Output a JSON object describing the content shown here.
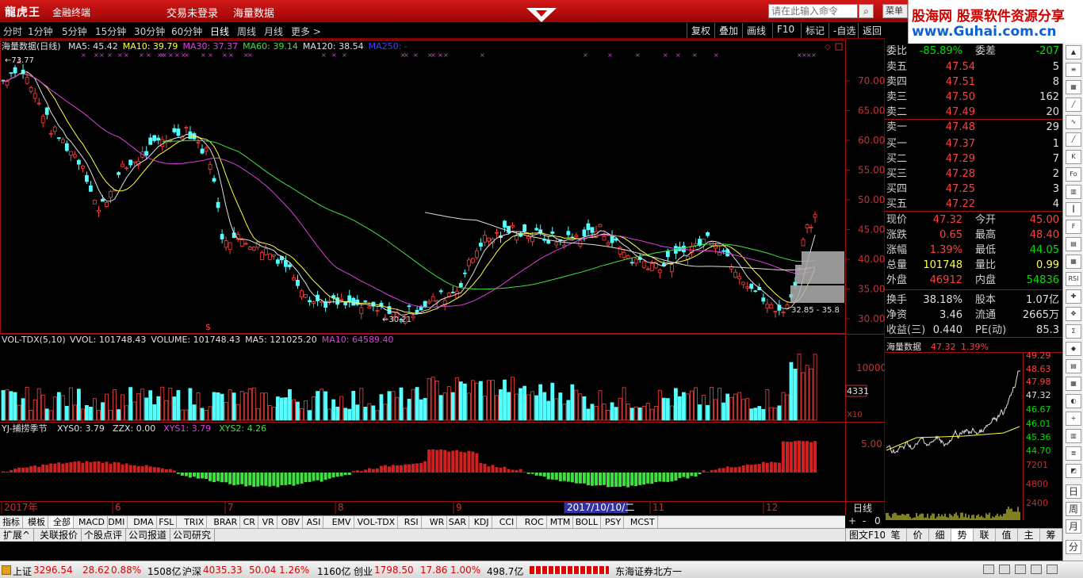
{
  "titlebar": {
    "logo": "龍虎王",
    "app_name": "金融终端",
    "menu": [
      "交易未登录",
      "海量数据"
    ],
    "command_placeholder": "请在此输入命令",
    "menu_button": "菜单"
  },
  "ad": {
    "line1_a": "股海网",
    "line1_b": "股票软件资源分享",
    "line2": "www.Guhai.com.cn"
  },
  "toolbar": {
    "periods": [
      "分时",
      "1分钟",
      "5分钟",
      "15分钟",
      "30分钟",
      "60分钟",
      "日线",
      "周线",
      "月线",
      "更多 >"
    ],
    "active_period": "日线",
    "buttons": [
      "复权",
      "叠加",
      "画线",
      "F10",
      "标记",
      "-自选",
      "返回"
    ]
  },
  "main_chart": {
    "title": "海量数据(日线)",
    "ma_labels": [
      {
        "text": "MA5: 45.42",
        "color": "#e0e0e0"
      },
      {
        "text": "MA10: 39.79",
        "color": "#ffff40"
      },
      {
        "text": "MA30: 37.37",
        "color": "#e040e0"
      },
      {
        "text": "MA60: 39.14",
        "color": "#40e040"
      },
      {
        "text": "MA120: 38.54",
        "color": "#e0e0e0"
      },
      {
        "text": "MA250: -",
        "color": "#4040ff"
      }
    ],
    "high_label": "73.77",
    "low_label": "30.21",
    "range_label": "32.85 - 35.8",
    "y_ticks": [
      "70.00",
      "65.00",
      "60.00",
      "55.00",
      "50.00",
      "45.00",
      "40.00",
      "35.00",
      "30.00"
    ],
    "y_tick_values": [
      70,
      65,
      60,
      55,
      50,
      45,
      40,
      35,
      30
    ]
  },
  "vol_chart": {
    "label_main": "VOL-TDX(5,10)",
    "labels": [
      {
        "text": "VVOL: 101748.43",
        "color": "#e0e0e0"
      },
      {
        "text": "VOLUME: 101748.43",
        "color": "#e0e0e0"
      },
      {
        "text": "MA5: 121025.20",
        "color": "#e0e0e0"
      },
      {
        "text": "MA10: 64589.40",
        "color": "#e040e0"
      }
    ],
    "y_tick": "10000",
    "box_value": "4331",
    "unit": "X10"
  },
  "ind_chart": {
    "label_main": "YJ-捕捞季节",
    "labels": [
      {
        "text": "XYS0: 3.79",
        "color": "#e0e0e0"
      },
      {
        "text": "ZZX: 0.00",
        "color": "#e0e0e0"
      },
      {
        "text": "XYS1: 3.79",
        "color": "#e040e0"
      },
      {
        "text": "XYS2: 4.26",
        "color": "#40e040"
      }
    ],
    "y_tick": "5.00"
  },
  "x_axis": {
    "labels": [
      "2017年",
      "6",
      "7",
      "8",
      "9",
      "2017/10/10/二",
      "11",
      "12"
    ],
    "right_label": "日线"
  },
  "order_book": {
    "weibi_label": "委比",
    "weibi": "-85.89%",
    "weicha_label": "委差",
    "weicha": "-207",
    "asks": [
      {
        "label": "卖五",
        "price": "47.54",
        "vol": "5"
      },
      {
        "label": "卖四",
        "price": "47.51",
        "vol": "8"
      },
      {
        "label": "卖三",
        "price": "47.50",
        "vol": "162"
      },
      {
        "label": "卖二",
        "price": "47.49",
        "vol": "20"
      },
      {
        "label": "卖一",
        "price": "47.48",
        "vol": "29"
      }
    ],
    "bids": [
      {
        "label": "买一",
        "price": "47.37",
        "vol": "1"
      },
      {
        "label": "买二",
        "price": "47.29",
        "vol": "7"
      },
      {
        "label": "买三",
        "price": "47.28",
        "vol": "2"
      },
      {
        "label": "买四",
        "price": "47.25",
        "vol": "3"
      },
      {
        "label": "买五",
        "price": "47.22",
        "vol": "4"
      }
    ],
    "stats": [
      {
        "l1": "现价",
        "v1": "47.32",
        "c1": "red",
        "l2": "今开",
        "v2": "45.00",
        "c2": "red"
      },
      {
        "l1": "涨跌",
        "v1": "0.65",
        "c1": "red",
        "l2": "最高",
        "v2": "48.40",
        "c2": "red"
      },
      {
        "l1": "涨幅",
        "v1": "1.39%",
        "c1": "red",
        "l2": "最低",
        "v2": "44.05",
        "c2": "grn"
      },
      {
        "l1": "总量",
        "v1": "101748",
        "c1": "yel",
        "l2": "量比",
        "v2": "0.99",
        "c2": "yel"
      },
      {
        "l1": "外盘",
        "v1": "46912",
        "c1": "red",
        "l2": "内盘",
        "v2": "54836",
        "c2": "grn"
      },
      {
        "l1": "换手",
        "v1": "38.18%",
        "c1": "wht",
        "l2": "股本",
        "v2": "1.07亿",
        "c2": "wht"
      },
      {
        "l1": "净资",
        "v1": "3.46",
        "c1": "wht",
        "l2": "流通",
        "v2": "2665万",
        "c2": "wht"
      },
      {
        "l1": "收益(三)",
        "v1": "0.440",
        "c1": "wht",
        "l2": "PE(动)",
        "v2": "85.3",
        "c2": "wht"
      }
    ]
  },
  "mini_chart": {
    "name": "海量数据",
    "price": "47.32",
    "pct": "1.39%",
    "ticks": [
      "49.29",
      "48.63",
      "47.98",
      "47.32",
      "46.67",
      "46.01",
      "45.36",
      "44.70",
      "7201",
      "4800",
      "2400"
    ]
  },
  "indicator_tabs": [
    "指标",
    "模板",
    "全部",
    "MACD",
    "DMI",
    "DMA",
    "FSL",
    "TRIX",
    "BRAR",
    "CR",
    "VR",
    "OBV",
    "ASI",
    "EMV",
    "VOL-TDX",
    "RSI",
    "WR",
    "SAR",
    "KDJ",
    "CCI",
    "ROC",
    "MTM",
    "BOLL",
    "PSY",
    "MCST"
  ],
  "active_indicator_tab": "全部",
  "scroll_controls": [
    "+",
    "-",
    "0"
  ],
  "bottom_tabs": [
    "扩展^",
    "关联报价",
    "个股点评",
    "公司报道",
    "公司研究"
  ],
  "bottom_right": "图文F10",
  "right_tabs": [
    "笔",
    "价",
    "细",
    "势",
    "联",
    "值",
    "主",
    "筹"
  ],
  "active_right_tab": "势",
  "side_buttons": [
    "K",
    "Fo",
    "RSI"
  ],
  "status": {
    "sh_label": "上证",
    "sh_val": "3296.54",
    "sh_chg": "28.62",
    "sh_pct": "0.88%",
    "sh_amt": "1508亿",
    "sz_label": "沪深",
    "sz_val": "4035.33",
    "sz_chg": "50.04",
    "sz_pct": "1.26%",
    "sz_amt": "1160亿",
    "cy_label": "创业",
    "cy_val": "1798.50",
    "cy_chg": "17.86",
    "cy_pct": "1.00%",
    "cy_amt": "498.7亿",
    "broker": "东海证券北方一"
  },
  "colors": {
    "up": "#ff4040",
    "down": "#54ffff",
    "ma5": "#e0e0e0",
    "ma10": "#ffff40",
    "ma30": "#e040e0",
    "ma60": "#40e040"
  }
}
